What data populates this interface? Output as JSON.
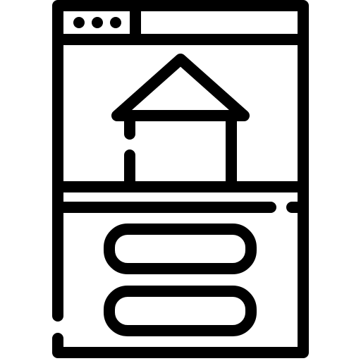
{
  "icon": {
    "name": "mobile-webpage-home-icon",
    "stroke_color": "#000000",
    "background_color": "#ffffff"
  }
}
